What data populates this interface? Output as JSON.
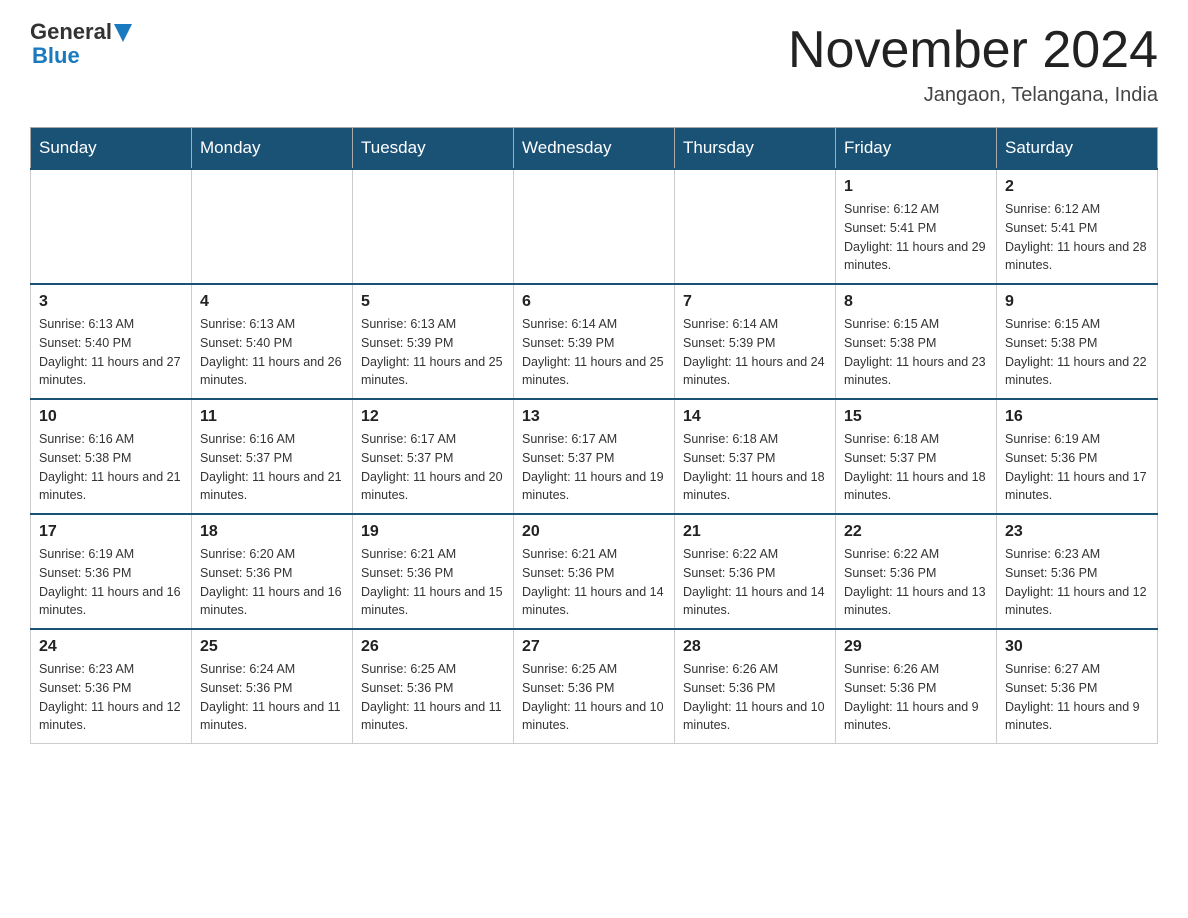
{
  "header": {
    "logo_general": "General",
    "logo_blue": "Blue",
    "month_title": "November 2024",
    "location": "Jangaon, Telangana, India"
  },
  "weekdays": [
    "Sunday",
    "Monday",
    "Tuesday",
    "Wednesday",
    "Thursday",
    "Friday",
    "Saturday"
  ],
  "weeks": [
    [
      {
        "day": "",
        "info": ""
      },
      {
        "day": "",
        "info": ""
      },
      {
        "day": "",
        "info": ""
      },
      {
        "day": "",
        "info": ""
      },
      {
        "day": "",
        "info": ""
      },
      {
        "day": "1",
        "info": "Sunrise: 6:12 AM\nSunset: 5:41 PM\nDaylight: 11 hours and 29 minutes."
      },
      {
        "day": "2",
        "info": "Sunrise: 6:12 AM\nSunset: 5:41 PM\nDaylight: 11 hours and 28 minutes."
      }
    ],
    [
      {
        "day": "3",
        "info": "Sunrise: 6:13 AM\nSunset: 5:40 PM\nDaylight: 11 hours and 27 minutes."
      },
      {
        "day": "4",
        "info": "Sunrise: 6:13 AM\nSunset: 5:40 PM\nDaylight: 11 hours and 26 minutes."
      },
      {
        "day": "5",
        "info": "Sunrise: 6:13 AM\nSunset: 5:39 PM\nDaylight: 11 hours and 25 minutes."
      },
      {
        "day": "6",
        "info": "Sunrise: 6:14 AM\nSunset: 5:39 PM\nDaylight: 11 hours and 25 minutes."
      },
      {
        "day": "7",
        "info": "Sunrise: 6:14 AM\nSunset: 5:39 PM\nDaylight: 11 hours and 24 minutes."
      },
      {
        "day": "8",
        "info": "Sunrise: 6:15 AM\nSunset: 5:38 PM\nDaylight: 11 hours and 23 minutes."
      },
      {
        "day": "9",
        "info": "Sunrise: 6:15 AM\nSunset: 5:38 PM\nDaylight: 11 hours and 22 minutes."
      }
    ],
    [
      {
        "day": "10",
        "info": "Sunrise: 6:16 AM\nSunset: 5:38 PM\nDaylight: 11 hours and 21 minutes."
      },
      {
        "day": "11",
        "info": "Sunrise: 6:16 AM\nSunset: 5:37 PM\nDaylight: 11 hours and 21 minutes."
      },
      {
        "day": "12",
        "info": "Sunrise: 6:17 AM\nSunset: 5:37 PM\nDaylight: 11 hours and 20 minutes."
      },
      {
        "day": "13",
        "info": "Sunrise: 6:17 AM\nSunset: 5:37 PM\nDaylight: 11 hours and 19 minutes."
      },
      {
        "day": "14",
        "info": "Sunrise: 6:18 AM\nSunset: 5:37 PM\nDaylight: 11 hours and 18 minutes."
      },
      {
        "day": "15",
        "info": "Sunrise: 6:18 AM\nSunset: 5:37 PM\nDaylight: 11 hours and 18 minutes."
      },
      {
        "day": "16",
        "info": "Sunrise: 6:19 AM\nSunset: 5:36 PM\nDaylight: 11 hours and 17 minutes."
      }
    ],
    [
      {
        "day": "17",
        "info": "Sunrise: 6:19 AM\nSunset: 5:36 PM\nDaylight: 11 hours and 16 minutes."
      },
      {
        "day": "18",
        "info": "Sunrise: 6:20 AM\nSunset: 5:36 PM\nDaylight: 11 hours and 16 minutes."
      },
      {
        "day": "19",
        "info": "Sunrise: 6:21 AM\nSunset: 5:36 PM\nDaylight: 11 hours and 15 minutes."
      },
      {
        "day": "20",
        "info": "Sunrise: 6:21 AM\nSunset: 5:36 PM\nDaylight: 11 hours and 14 minutes."
      },
      {
        "day": "21",
        "info": "Sunrise: 6:22 AM\nSunset: 5:36 PM\nDaylight: 11 hours and 14 minutes."
      },
      {
        "day": "22",
        "info": "Sunrise: 6:22 AM\nSunset: 5:36 PM\nDaylight: 11 hours and 13 minutes."
      },
      {
        "day": "23",
        "info": "Sunrise: 6:23 AM\nSunset: 5:36 PM\nDaylight: 11 hours and 12 minutes."
      }
    ],
    [
      {
        "day": "24",
        "info": "Sunrise: 6:23 AM\nSunset: 5:36 PM\nDaylight: 11 hours and 12 minutes."
      },
      {
        "day": "25",
        "info": "Sunrise: 6:24 AM\nSunset: 5:36 PM\nDaylight: 11 hours and 11 minutes."
      },
      {
        "day": "26",
        "info": "Sunrise: 6:25 AM\nSunset: 5:36 PM\nDaylight: 11 hours and 11 minutes."
      },
      {
        "day": "27",
        "info": "Sunrise: 6:25 AM\nSunset: 5:36 PM\nDaylight: 11 hours and 10 minutes."
      },
      {
        "day": "28",
        "info": "Sunrise: 6:26 AM\nSunset: 5:36 PM\nDaylight: 11 hours and 10 minutes."
      },
      {
        "day": "29",
        "info": "Sunrise: 6:26 AM\nSunset: 5:36 PM\nDaylight: 11 hours and 9 minutes."
      },
      {
        "day": "30",
        "info": "Sunrise: 6:27 AM\nSunset: 5:36 PM\nDaylight: 11 hours and 9 minutes."
      }
    ]
  ]
}
